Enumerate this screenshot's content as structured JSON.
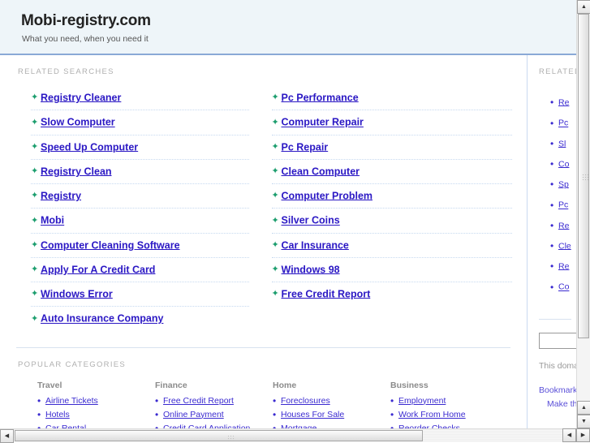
{
  "header": {
    "title": "Mobi-registry.com",
    "tagline": "What you need, when you need it"
  },
  "sections": {
    "related_searches_label": "RELATED SEARCHES",
    "popular_categories_label": "POPULAR CATEGORIES",
    "sidebar_related_label": "RELATED"
  },
  "related_searches": {
    "left": [
      "Registry Cleaner",
      "Slow Computer",
      "Speed Up Computer",
      "Registry Clean",
      "Registry",
      "Mobi",
      "Computer Cleaning Software",
      "Apply For A Credit Card",
      "Windows Error",
      "Auto Insurance Company"
    ],
    "right": [
      "Pc Performance",
      "Computer Repair",
      "Pc Repair",
      "Clean Computer",
      "Computer Problem",
      "Silver Coins",
      "Car Insurance",
      "Windows 98",
      "Free Credit Report"
    ]
  },
  "popular_categories": [
    {
      "heading": "Travel",
      "links": [
        "Airline Tickets",
        "Hotels",
        "Car Rental"
      ]
    },
    {
      "heading": "Finance",
      "links": [
        "Free Credit Report",
        "Online Payment",
        "Credit Card Application"
      ]
    },
    {
      "heading": "Home",
      "links": [
        "Foreclosures",
        "Houses For Sale",
        "Mortgage"
      ]
    },
    {
      "heading": "Business",
      "links": [
        "Employment",
        "Work From Home",
        "Reorder Checks"
      ]
    }
  ],
  "sidebar": {
    "links": [
      "Re",
      "Pc",
      "Sl",
      "Co",
      "Sp",
      "Pc",
      "Re",
      "Cle",
      "Re",
      "Co"
    ],
    "input_value": "",
    "note": "This doma",
    "action_primary": "Bookmark",
    "action_secondary": "Make thi"
  },
  "icons": {
    "arrow_bullet": "✦",
    "round_bullet": "•",
    "scroll_up": "▲",
    "scroll_down": "▼",
    "scroll_left": "◀",
    "scroll_right": "▶"
  },
  "colors": {
    "header_bg": "#eef5f9",
    "header_border": "#8aa9d6",
    "link": "#2b18c4",
    "arrow_green": "#1d9e6e",
    "label_gray": "#b0b0b0",
    "dotted_rule": "#c6d9f0"
  }
}
